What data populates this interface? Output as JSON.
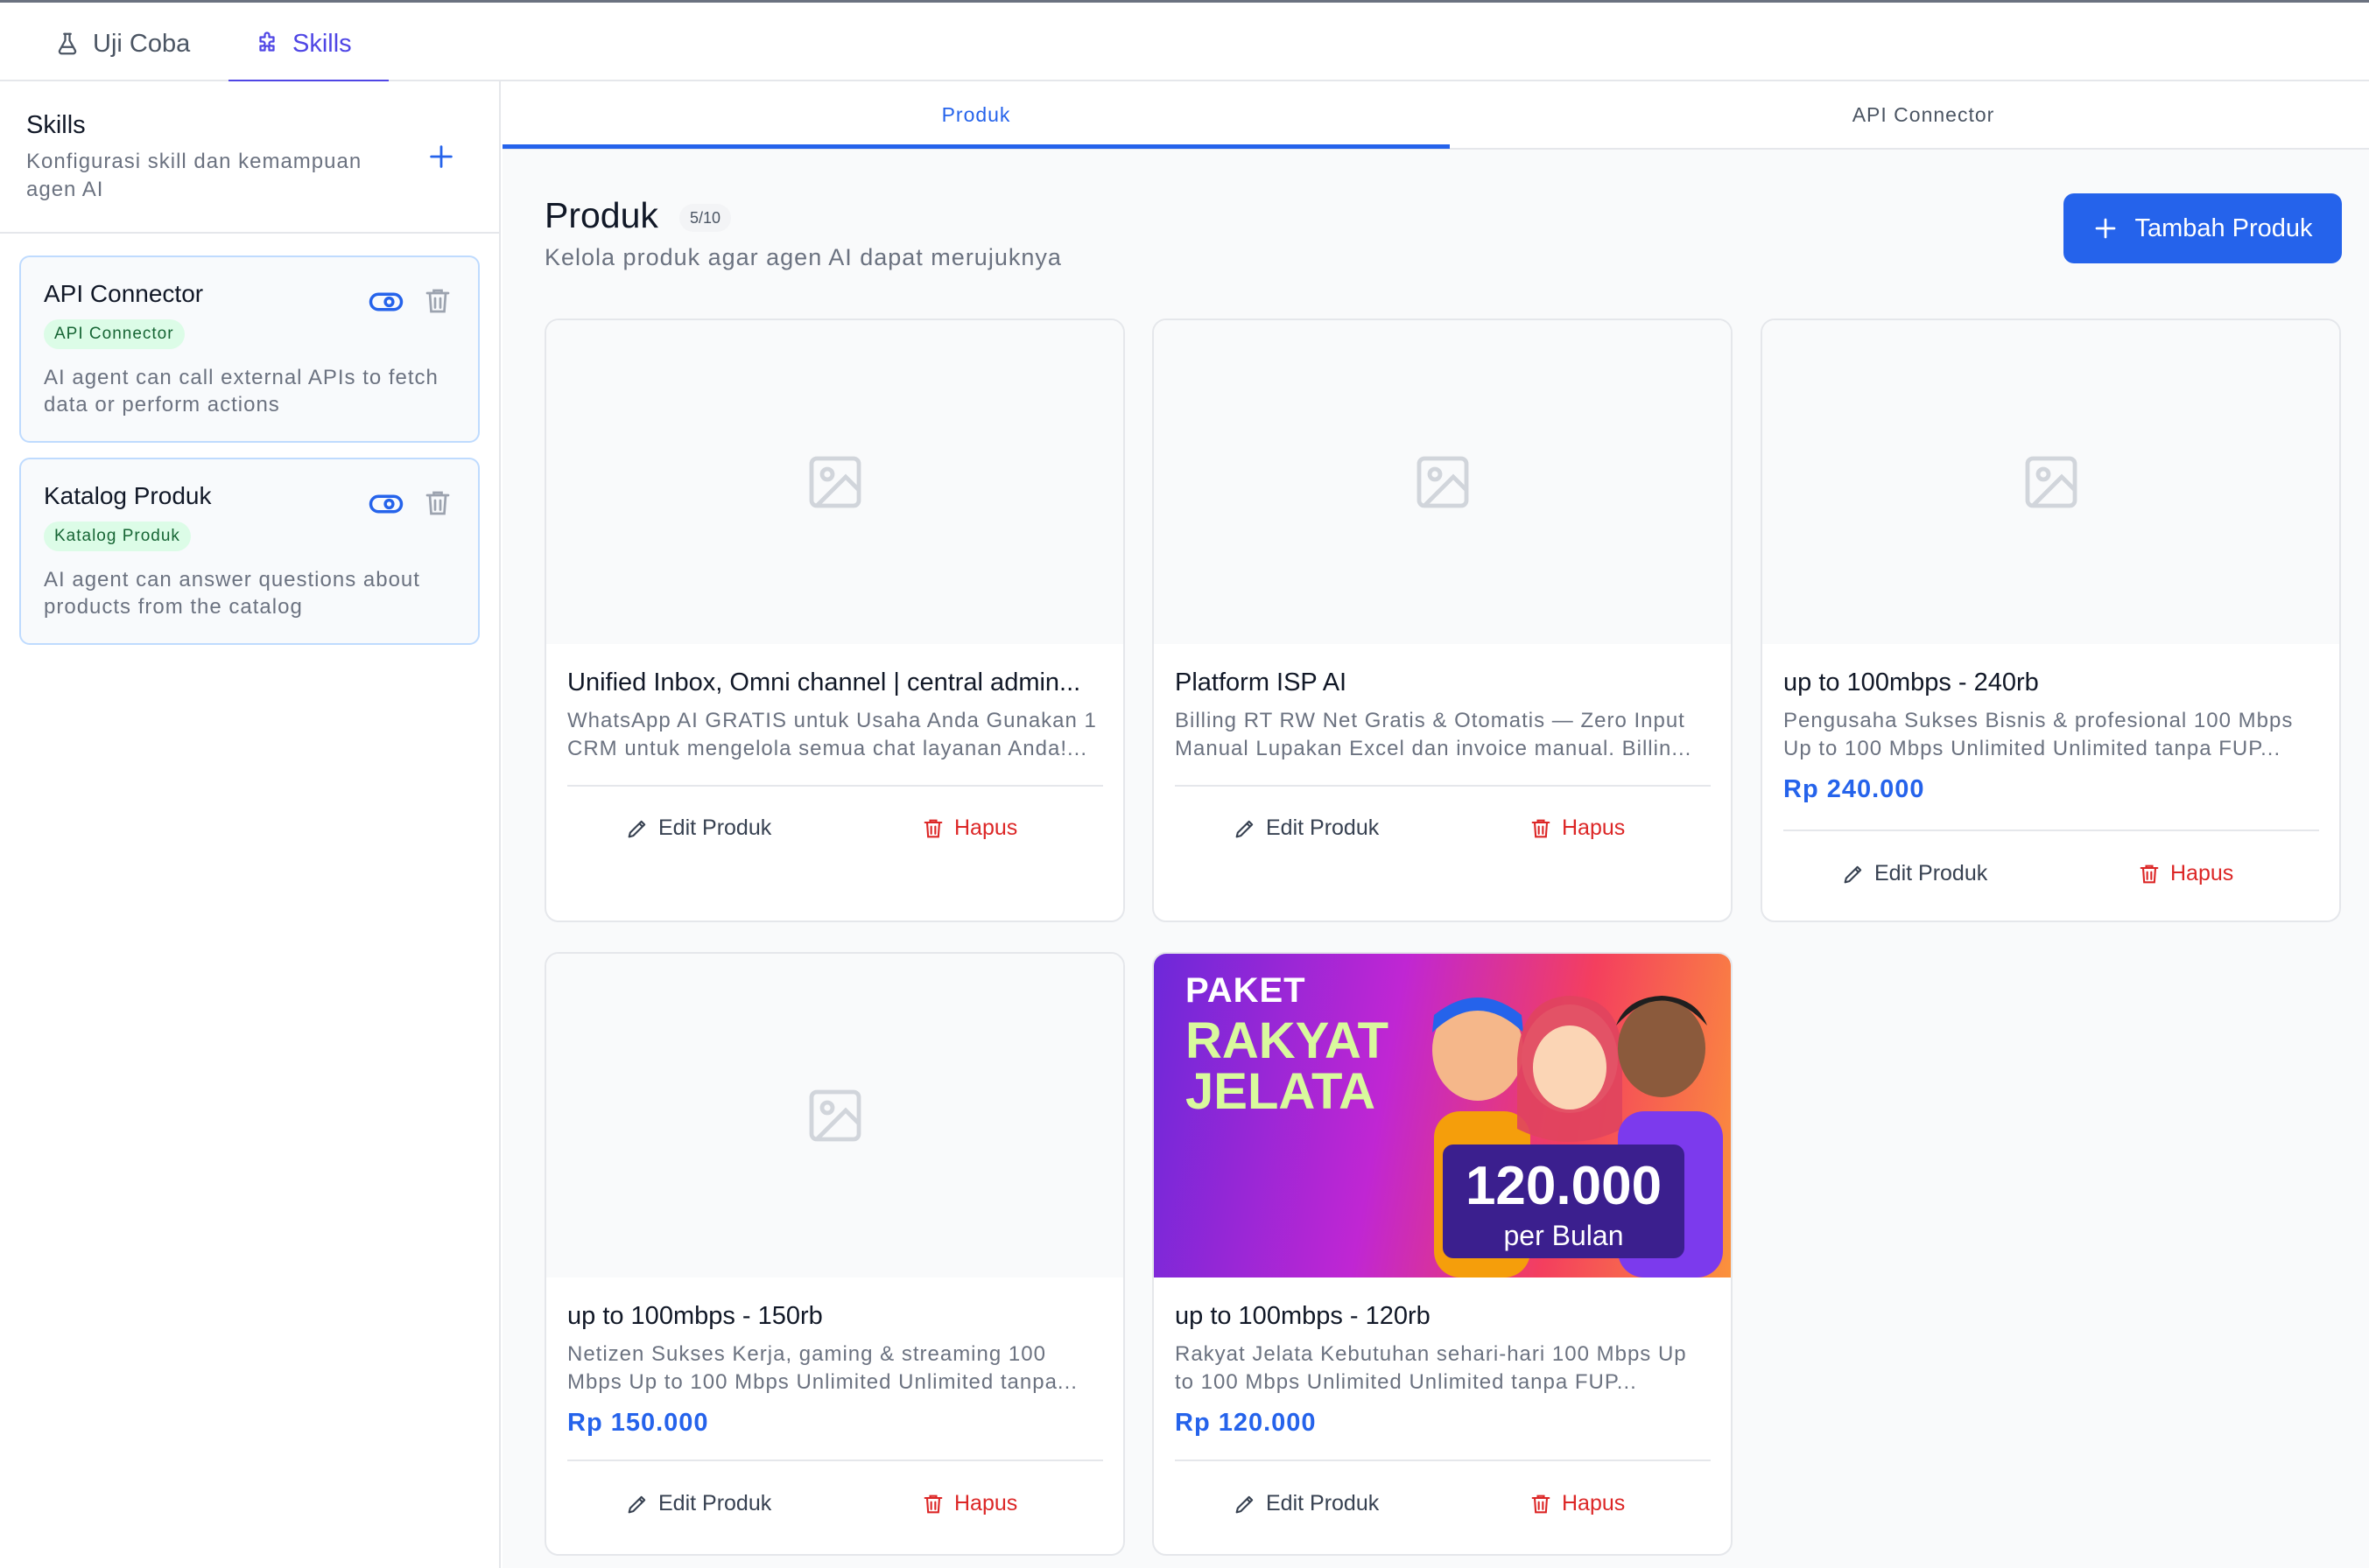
{
  "top_tabs": [
    {
      "label": "Uji Coba",
      "icon": "flask-icon"
    },
    {
      "label": "Skills",
      "icon": "puzzle-icon",
      "active": true
    }
  ],
  "sidebar": {
    "title": "Skills",
    "subtitle": "Konfigurasi skill dan kemampuan agen AI",
    "skills": [
      {
        "name": "API Connector",
        "badge": "API Connector",
        "description": "AI agent can call external APIs to fetch data or perform actions"
      },
      {
        "name": "Katalog Produk",
        "badge": "Katalog Produk",
        "description": "AI agent can answer questions about products from the catalog"
      }
    ]
  },
  "main": {
    "tabs": [
      {
        "label": "Produk",
        "active": true
      },
      {
        "label": "API Connector"
      }
    ],
    "title": "Produk",
    "count": "5/10",
    "subtitle": "Kelola produk agar agen AI dapat merujuknya",
    "add_button": "Tambah Produk",
    "edit_label": "Edit Produk",
    "delete_label": "Hapus",
    "products": [
      {
        "name": "Unified Inbox, Omni channel | central admin...",
        "description": "WhatsApp AI GRATIS untuk Usaha Anda Gunakan 1 CRM untuk mengelola semua chat layanan Anda!...",
        "price": ""
      },
      {
        "name": "Platform ISP AI",
        "description": "Billing RT RW Net Gratis & Otomatis — Zero Input Manual Lupakan Excel dan invoice manual. Billin...",
        "price": ""
      },
      {
        "name": "up to 100mbps - 240rb",
        "description": "Pengusaha Sukses Bisnis & profesional 100 Mbps Up to 100 Mbps Unlimited Unlimited tanpa FUP...",
        "price": "Rp 240.000"
      },
      {
        "name": "up to 100mbps - 150rb",
        "description": "Netizen Sukses Kerja, gaming & streaming 100 Mbps Up to 100 Mbps Unlimited Unlimited tanpa...",
        "price": "Rp 150.000"
      },
      {
        "name": "up to 100mbps - 120rb",
        "description": "Rakyat Jelata Kebutuhan sehari-hari 100 Mbps Up to 100 Mbps Unlimited Unlimited tanpa FUP...",
        "price": "Rp 120.000",
        "banner": {
          "line1": "PAKET",
          "line2": "RAKYAT",
          "line3": "JELATA",
          "price": "120.000",
          "period": "per Bulan"
        }
      }
    ]
  },
  "colors": {
    "accent": "#2563eb",
    "danger": "#dc2626",
    "badge_bg": "#dcfce7",
    "badge_text": "#166534"
  }
}
